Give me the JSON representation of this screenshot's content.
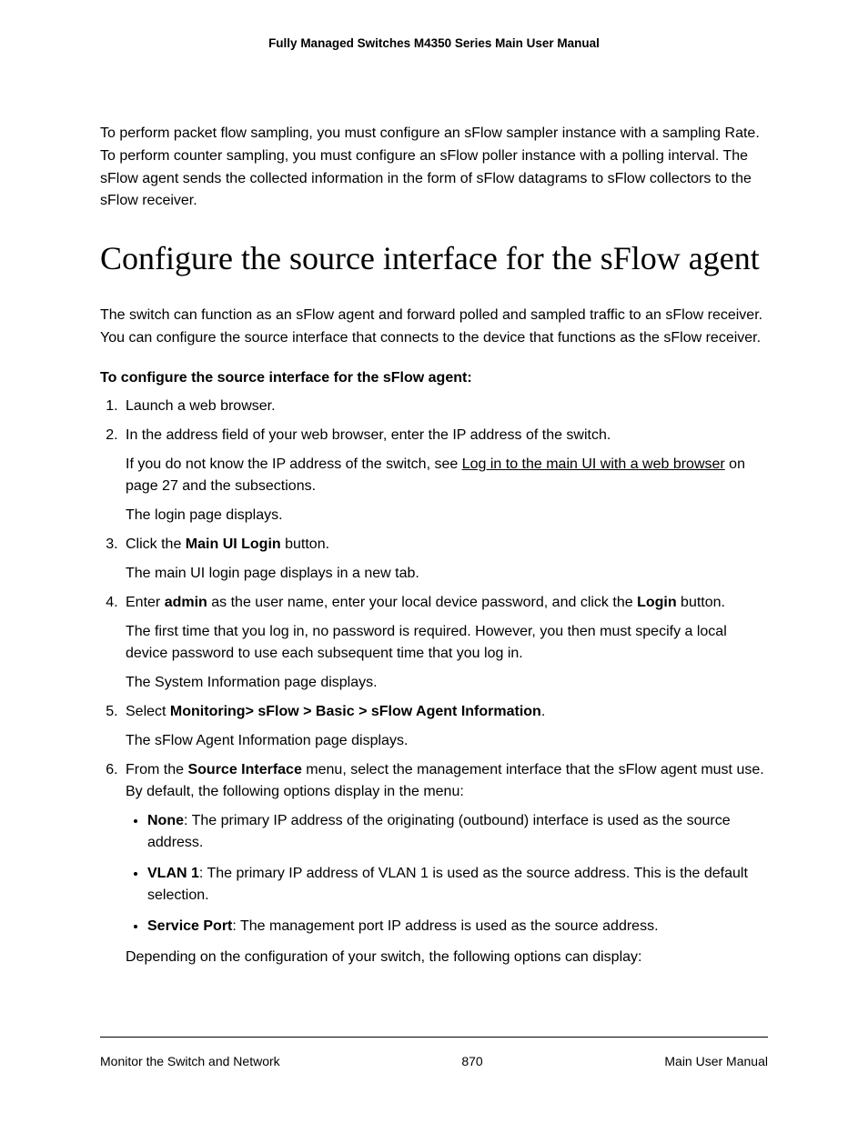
{
  "header": {
    "title": "Fully Managed Switches M4350 Series Main User Manual"
  },
  "intro": {
    "p1": "To perform packet flow sampling, you must configure an sFlow sampler instance with a sampling Rate. To perform counter sampling, you must configure an sFlow poller instance with a polling interval. The sFlow agent sends the collected information in the form of sFlow datagrams to sFlow collectors to the sFlow receiver."
  },
  "section": {
    "title": "Configure the source interface for the sFlow agent",
    "p1": "The switch can function as an sFlow agent and forward polled and sampled traffic to an sFlow receiver. You can configure the source interface that connects to the device that functions as the sFlow receiver.",
    "subhead": "To configure the source interface for the sFlow agent:"
  },
  "steps": {
    "s1": "Launch a web browser.",
    "s2": "In the address field of your web browser, enter the IP address of the switch.",
    "s2a_pre": "If you do not know the IP address of the switch, see ",
    "s2a_link": "Log in to the main UI with a web browser",
    "s2a_post": " on page 27 and the subsections.",
    "s2b": "The login page displays.",
    "s3_pre": "Click the ",
    "s3_bold": "Main UI Login",
    "s3_post": " button.",
    "s3a": "The main UI login page displays in a new tab.",
    "s4_pre": "Enter ",
    "s4_admin": "admin",
    "s4_mid": " as the user name, enter your local device password, and click the ",
    "s4_login": "Login",
    "s4_post": " button.",
    "s4a": "The first time that you log in, no password is required. However, you then must specify a local device password to use each subsequent time that you log in.",
    "s4b": "The System Information page displays.",
    "s5_pre": "Select ",
    "s5_bold": "Monitoring> sFlow > Basic > sFlow Agent Information",
    "s5_post": ".",
    "s5a": "The sFlow Agent Information page displays.",
    "s6_pre": "From the ",
    "s6_bold": "Source Interface",
    "s6_post": " menu, select the management interface that the sFlow agent must use. By default, the following options display in the menu:",
    "b1_bold": "None",
    "b1_post": ": The primary IP address of the originating (outbound) interface is used as the source address.",
    "b2_bold": "VLAN 1",
    "b2_post": ": The primary IP address of VLAN 1 is used as the source address. This is the default selection.",
    "b3_bold": "Service Port",
    "b3_post": ": The management port IP address is used as the source address.",
    "s6_after": "Depending on the configuration of your switch, the following options can display:"
  },
  "footer": {
    "left": "Monitor the Switch and Network",
    "center": "870",
    "right": "Main User Manual"
  }
}
